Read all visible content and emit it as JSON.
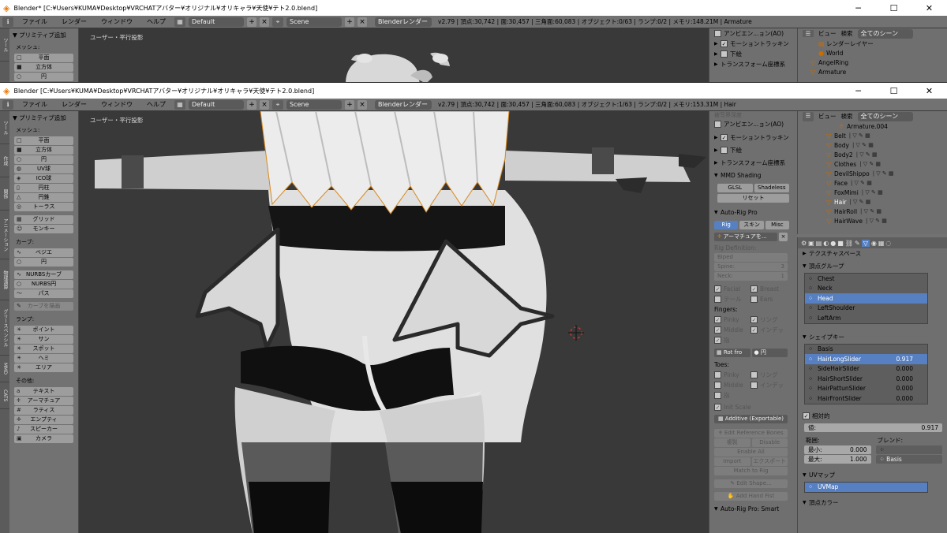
{
  "win_back": {
    "title": "Blender* [C:¥Users¥KUMA¥Desktop¥VRCHATアバター¥オリジナル¥オリキャラ¥天使¥テト2.0.blend]",
    "menu": [
      "ファイル",
      "レンダー",
      "ウィンドウ",
      "ヘルプ"
    ],
    "layout": "Default",
    "scene": "Scene",
    "engine": "Blenderレンダー",
    "stats": "v2.79 | 頂点:30,742 | 面:30,457 | 三角面:60,083 | オブジェクト:0/63 | ランプ:0/2 | メモリ:148.21M | Armature",
    "viewport_label": "ユーザー・平行投影",
    "tool_header": "▼ プリミティブ追加",
    "tool_items": [
      "メッシュ:",
      "平面",
      "立方体",
      "円"
    ],
    "npanel": [
      "アンビエン...ョン(AO)",
      "モーショントラッキン",
      "下絵",
      "トランスフォーム座標系"
    ],
    "outliner": {
      "view": "ビュー",
      "search": "検索",
      "filter": "全てのシーン",
      "rows": [
        "レンダーレイヤー",
        "World",
        "AngelRing",
        "Armature"
      ]
    }
  },
  "win_front": {
    "title": "Blender [C:¥Users¥KUMA¥Desktop¥VRCHATアバター¥オリジナル¥オリキャラ¥天使¥テト2.0.blend]",
    "menu": [
      "ファイル",
      "レンダー",
      "ウィンドウ",
      "ヘルプ"
    ],
    "layout": "Default",
    "scene": "Scene",
    "engine": "Blenderレンダー",
    "stats": "v2.79 | 頂点:30,742 | 面:30,457 | 三角面:60,083 | オブジェクト:1/63 | ランプ:0/2 | メモリ:153.31M | Hair",
    "viewport_label": "ユーザー・平行投影",
    "tool_tabs": [
      "ツール",
      "作成",
      "関係",
      "アニメーション",
      "物理演算",
      "グリースペンシル",
      "MMD",
      "CATS"
    ],
    "tool": {
      "header": "▼ プリミティブ追加",
      "mesh_label": "メッシュ:",
      "mesh": [
        "平面",
        "立方体",
        "円",
        "UV球",
        "ICO球",
        "円柱",
        "円錐",
        "トーラス",
        "グリッド",
        "モンキー"
      ],
      "curve_label": "カーブ:",
      "curve": [
        "ベジエ",
        "円",
        "NURBSカーブ",
        "NURBS円",
        "パス",
        "カーブを描画"
      ],
      "lamp_label": "ランプ:",
      "lamp": [
        "ポイント",
        "サン",
        "スポット",
        "ヘミ",
        "エリア"
      ],
      "other_label": "その他:",
      "other": [
        "テキスト",
        "アーマチュア",
        "ラティス",
        "エンプティ",
        "スピーカー",
        "カメラ"
      ]
    },
    "npanel": {
      "top_cut": "被写界深度",
      "ao": "アンビエン...ョン(AO)",
      "motion": "モーショントラッキン",
      "bg": "下絵",
      "transform": "トランスフォーム座標系",
      "mmd": "MMD Shading",
      "glsl": "GLSL",
      "shadeless": "Shadeless",
      "reset": "リセット",
      "autorig": "Auto-Rig Pro",
      "tabs": [
        "Rig",
        "スキン",
        "Misc"
      ],
      "armature_field": "アーマチュアを...",
      "rig_def": "Rig Definition:",
      "biped": "Biped",
      "spine_label": "Spine:",
      "spine": "3",
      "neck_label": "Neck:",
      "neck": "1",
      "opts": [
        [
          "Facial",
          "Breast"
        ],
        [
          "テール",
          "Ears"
        ]
      ],
      "fingers": "Fingers:",
      "finger_opts": [
        [
          "Pinky",
          "リング"
        ],
        [
          "Middle",
          "インデッ"
        ],
        [
          "指",
          ""
        ]
      ],
      "rot": "Rot fro",
      "rot2": "円",
      "toes": "Toes:",
      "toe_opts": [
        [
          "Pinky",
          "リング"
        ],
        [
          "Middle",
          "インデッ"
        ],
        [
          "指",
          ""
        ]
      ],
      "init_scale": "Init Scale",
      "additive": "Additive (Exportable)",
      "edit_ref": "Edit Reference Bones",
      "copy": "複製",
      "disable": "Disable",
      "enable_all": "Enable All",
      "import": "Import",
      "export": "エクスポート",
      "match": "Match to Rig",
      "edit_shape": "Edit Shape...",
      "hand_fist": "Add Hand Fist",
      "smart": "Auto-Rig Pro: Smart"
    },
    "outliner": {
      "view": "ビュー",
      "search": "検索",
      "filter": "全てのシーン",
      "rows": [
        "Armature.004",
        "Belt",
        "Body",
        "Body2",
        "Clothes",
        "DevilShippo",
        "Face",
        "FoxMimi",
        "Hair",
        "HairRoll",
        "HairWave"
      ]
    },
    "props": {
      "texture_space": "テクスチャスペース",
      "vgroup_title": "頂点グループ",
      "vgroups": [
        "Chest",
        "Neck",
        "Head",
        "LeftShoulder",
        "LeftArm"
      ],
      "vgroup_selected": "Head",
      "shape_title": "シェイプキー",
      "shapekeys": [
        {
          "name": "Basis",
          "value": ""
        },
        {
          "name": "HairLongSlider",
          "value": "0.917"
        },
        {
          "name": "SideHairSlider",
          "value": "0.000"
        },
        {
          "name": "HairShortSlider",
          "value": "0.000"
        },
        {
          "name": "HairPattunSlider",
          "value": "0.000"
        },
        {
          "name": "HairFrontSlider",
          "value": "0.000"
        }
      ],
      "relative": "相対的",
      "value_label": "値:",
      "value": "0.917",
      "range_label": "範囲:",
      "min_label": "最小:",
      "min": "0.000",
      "max_label": "最大:",
      "max": "1.000",
      "blend_label": "ブレンド:",
      "blend": "Basis",
      "uv_title": "UVマップ",
      "uvmap": "UVMap",
      "vcolor_title": "頂点カラー"
    }
  }
}
